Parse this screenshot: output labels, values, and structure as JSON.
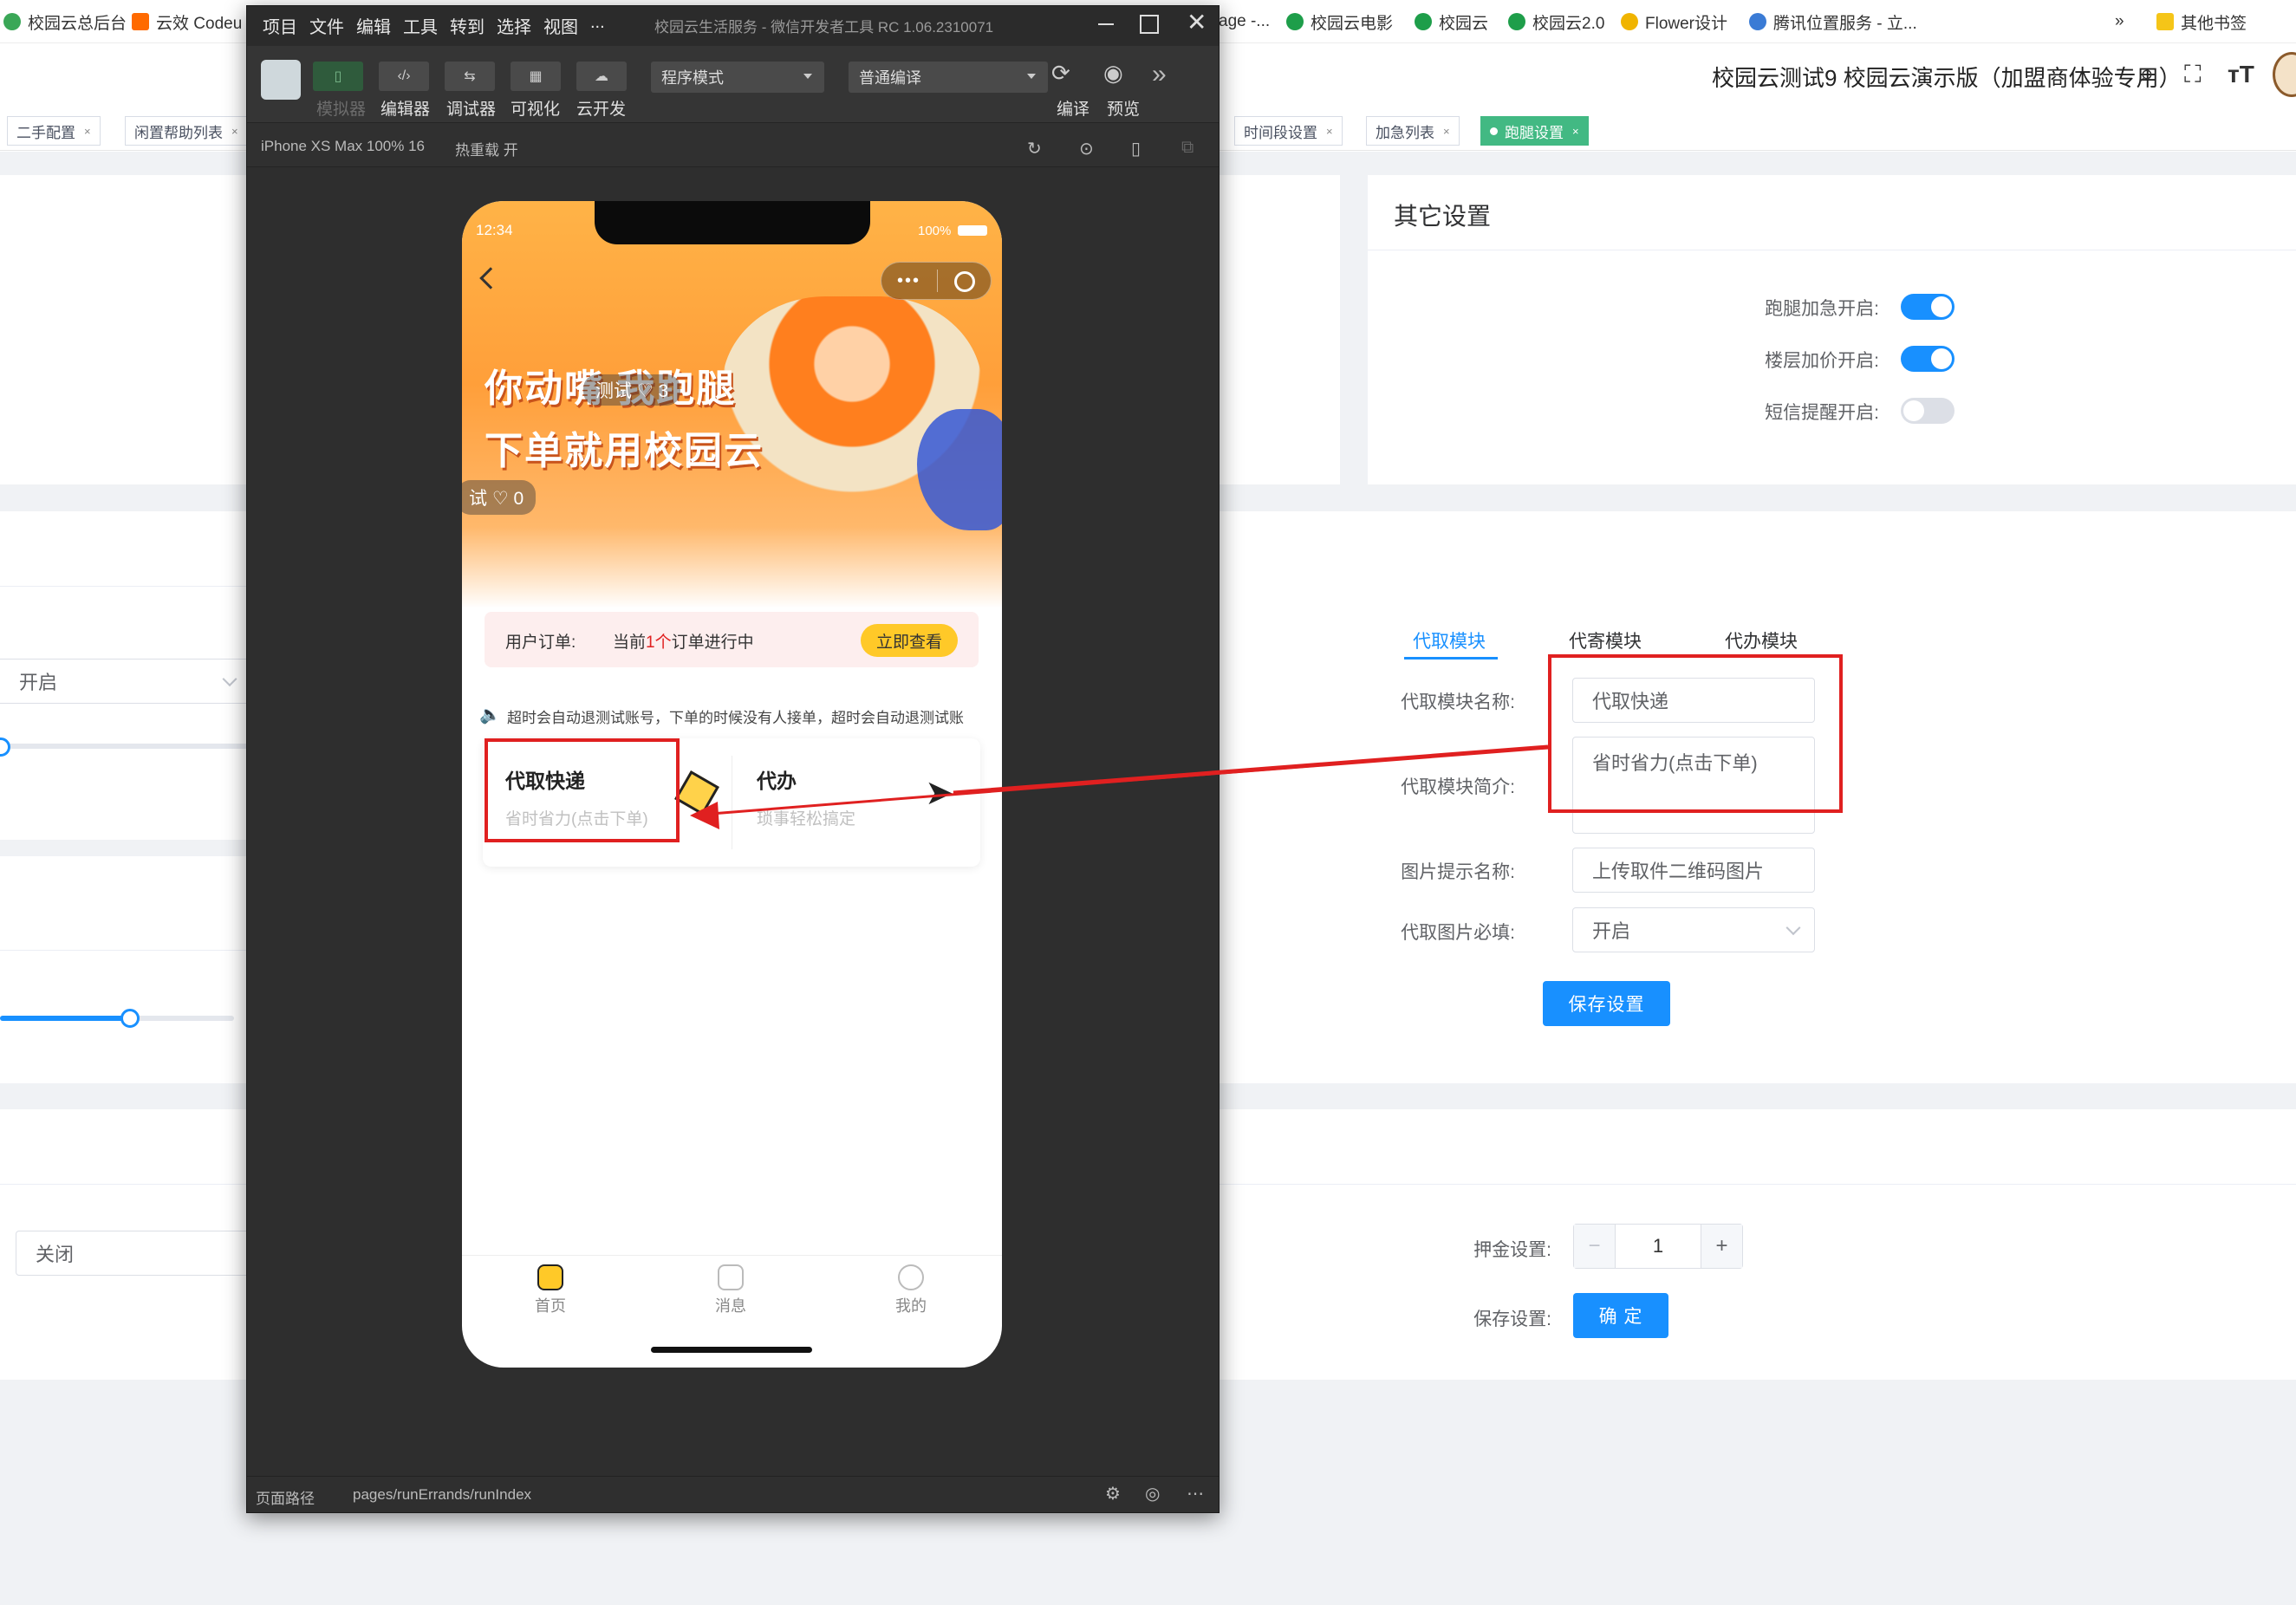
{
  "bookmarks": {
    "items": [
      "校园云总后台",
      "云效 Codeu",
      "age -...",
      "校园云电影",
      "校园云",
      "校园云2.0",
      "Flower设计",
      "腾讯位置服务 - 立...",
      "»",
      "其他书签"
    ]
  },
  "admin": {
    "title": "校园云测试9 校园云演示版（加盟商体验专用）",
    "tags": [
      "二手配置",
      "闲置帮助列表",
      "时间段设置",
      "加急列表",
      "跑腿设置"
    ],
    "other_settings": {
      "title": "其它设置",
      "rows": [
        {
          "label": "跑腿加急开启:",
          "on": true
        },
        {
          "label": "楼层加价开启:",
          "on": true
        },
        {
          "label": "短信提醒开启:",
          "on": false
        }
      ]
    },
    "left_cards": {
      "select_open": "开启",
      "select_close": "关闭"
    },
    "module": {
      "tabs": [
        "代取模块",
        "代寄模块",
        "代办模块"
      ],
      "name_label": "代取模块名称:",
      "name_value": "代取快递",
      "intro_label": "代取模块简介:",
      "intro_value": "省时省力(点击下单)",
      "img_tip_label": "图片提示名称:",
      "img_tip_value": "上传取件二维码图片",
      "img_required_label": "代取图片必填:",
      "img_required_value": "开启",
      "save_label": "保存设置"
    },
    "deposit": {
      "label": "押金设置:",
      "value": "1",
      "minus": "−",
      "plus": "+",
      "save_label": "保存设置:",
      "confirm": "确 定"
    }
  },
  "devtools": {
    "menu": [
      "项目",
      "文件",
      "编辑",
      "工具",
      "转到",
      "选择",
      "视图",
      "..."
    ],
    "title": "校园云生活服务 - 微信开发者工具 RC 1.06.2310071",
    "toolbar": {
      "buttons": [
        "模拟器",
        "编辑器",
        "调试器",
        "可视化",
        "云开发"
      ],
      "mode": "程序模式",
      "compile_mode": "普通编译",
      "compile": "编译",
      "preview": "预览"
    },
    "sim_device": "iPhone XS Max 100% 16",
    "hot_reload": "热重载 开",
    "status_path_label": "页面路径",
    "status_path": "pages/runErrands/runIndex"
  },
  "phone": {
    "time": "12:34",
    "battery": "100%",
    "banner_line1": "你动嘴 我跑腿",
    "banner_line2": "下单就用校园云",
    "danmaku1": "测试 ♡ 3",
    "danmaku2": "试 ♡ 0",
    "order_label": "用户订单:",
    "order_prefix": "当前",
    "order_count": "1个",
    "order_suffix": "订单进行中",
    "order_btn": "立即查看",
    "notice": "超时会自动退测试账号，下单的时候没有人接单，超时会自动退测试账",
    "svc1_title": "代取快递",
    "svc1_sub": "省时省力(点击下单)",
    "svc2_title": "代办",
    "svc2_sub": "琐事轻松搞定",
    "tabbar": [
      "首页",
      "消息",
      "我的"
    ]
  },
  "colors": {
    "accent": "#1890ff",
    "active_tag": "#42b983",
    "annotation": "#e02020",
    "banner": "#ff9f3a"
  }
}
